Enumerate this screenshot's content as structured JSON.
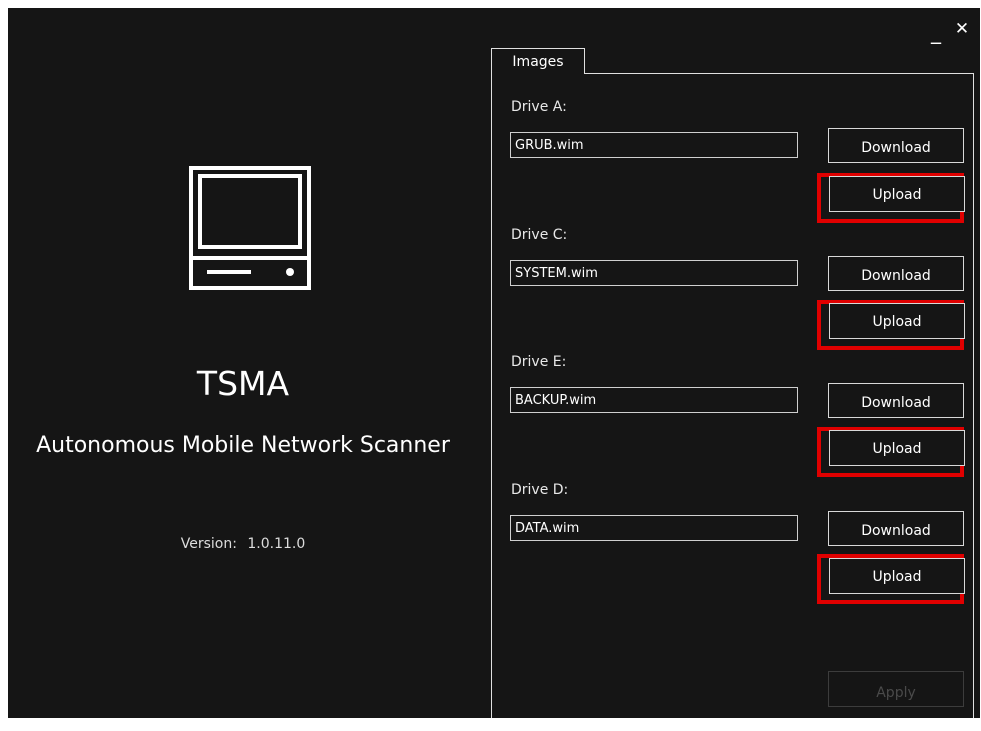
{
  "window": {
    "minimize_glyph": "_",
    "close_glyph": "✕"
  },
  "brand": {
    "icon": "computer-monitor-icon",
    "title": "TSMA",
    "subtitle": "Autonomous Mobile Network Scanner",
    "version_label": "Version:",
    "version_value": "1.0.11.0"
  },
  "tabs": [
    {
      "label": "Images",
      "active": true
    }
  ],
  "drives": [
    {
      "label": "Drive A:",
      "file": "GRUB.wim",
      "download_label": "Download",
      "upload_label": "Upload",
      "upload_highlighted": true
    },
    {
      "label": "Drive C:",
      "file": "SYSTEM.wim",
      "download_label": "Download",
      "upload_label": "Upload",
      "upload_highlighted": true
    },
    {
      "label": "Drive E:",
      "file": "BACKUP.wim",
      "download_label": "Download",
      "upload_label": "Upload",
      "upload_highlighted": true
    },
    {
      "label": "Drive D:",
      "file": "DATA.wim",
      "download_label": "Download",
      "upload_label": "Upload",
      "upload_highlighted": true
    }
  ],
  "apply_button": {
    "label": "Apply",
    "enabled": false
  },
  "colors": {
    "background": "#151515",
    "foreground": "#ffffff",
    "highlight": "#e00000",
    "disabled_text": "#4a4a4a"
  }
}
